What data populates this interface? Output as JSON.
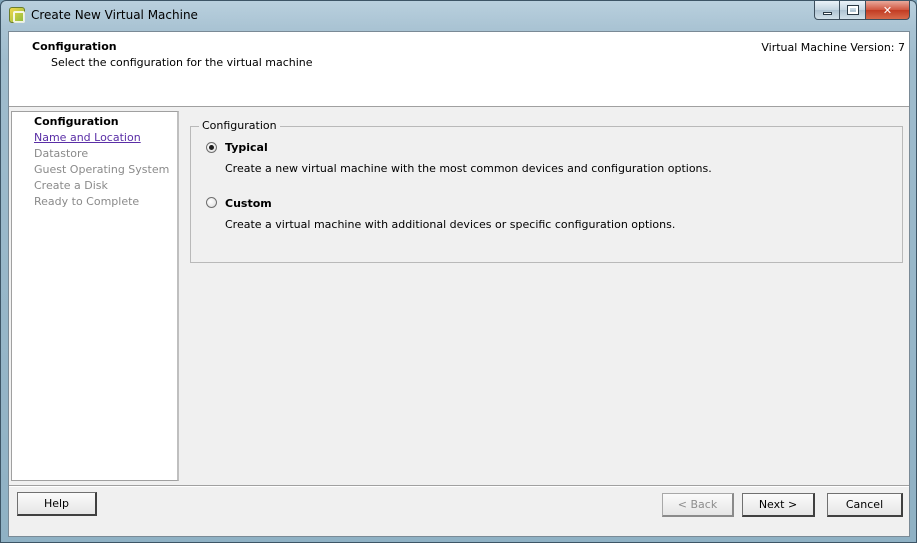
{
  "window": {
    "title": "Create New Virtual Machine",
    "controls": {
      "minimize_icon": "minimize-icon",
      "maximize_icon": "maximize-icon",
      "close_icon": "close-icon",
      "close_glyph": "✕"
    }
  },
  "header": {
    "title": "Configuration",
    "subtitle": "Select the configuration for the virtual machine",
    "version": "Virtual Machine Version: 7"
  },
  "steps": [
    {
      "label": "Configuration",
      "state": "current"
    },
    {
      "label": "Name and Location",
      "state": "link"
    },
    {
      "label": "Datastore",
      "state": "disabled"
    },
    {
      "label": "Guest Operating System",
      "state": "disabled"
    },
    {
      "label": "Create a Disk",
      "state": "disabled"
    },
    {
      "label": "Ready to Complete",
      "state": "disabled"
    }
  ],
  "config_group": {
    "legend": "Configuration",
    "options": [
      {
        "label": "Typical",
        "description": "Create a new virtual machine with the most common devices and configuration options.",
        "selected": true
      },
      {
        "label": "Custom",
        "description": "Create a virtual machine with additional devices or specific configuration options.",
        "selected": false
      }
    ]
  },
  "buttons": {
    "help": "Help",
    "back": "< Back",
    "next": "Next >",
    "cancel": "Cancel"
  },
  "colors": {
    "link": "#5a2ea6",
    "disabled_text": "#8a8a8a",
    "panel_bg": "#f0f0f0"
  }
}
